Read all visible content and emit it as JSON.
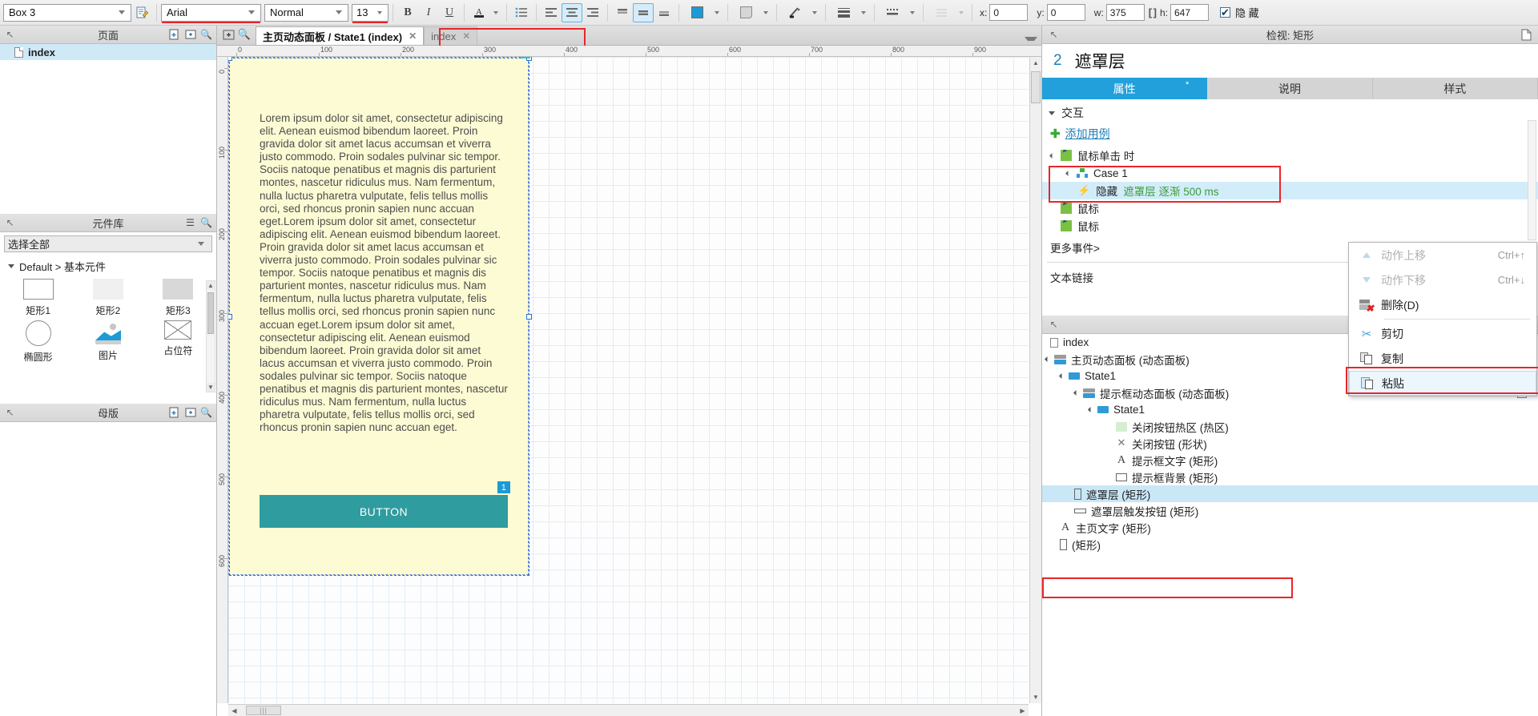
{
  "toolbar": {
    "widget_name": "Box 3",
    "font_family": "Arial",
    "font_style": "Normal",
    "font_size": "13",
    "bold": "B",
    "italic": "I",
    "underline": "U",
    "x_label": "x:",
    "x_value": "0",
    "y_label": "y:",
    "y_value": "0",
    "w_label": "w:",
    "w_value": "375",
    "h_label": "h:",
    "h_value": "647",
    "hide_label": "隐 藏",
    "hide_checked": true
  },
  "pages_panel": {
    "title": "页面",
    "items": [
      {
        "label": "index",
        "selected": true
      }
    ]
  },
  "library_panel": {
    "title": "元件库",
    "select_value": "选择全部",
    "group_label": "Default > 基本元件",
    "widgets": [
      {
        "label": "矩形1",
        "shape": "rect-outline"
      },
      {
        "label": "矩形2",
        "shape": "rect-light"
      },
      {
        "label": "矩形3",
        "shape": "rect-grey"
      },
      {
        "label": "椭圆形",
        "shape": "ellipse"
      },
      {
        "label": "图片",
        "shape": "image"
      },
      {
        "label": "占位符",
        "shape": "placeholder"
      }
    ]
  },
  "masters_panel": {
    "title": "母版"
  },
  "canvas": {
    "tabs": [
      {
        "label": "主页动态面板 / State1 (index)",
        "active": true,
        "highlighted": true
      },
      {
        "label": "index",
        "active": false,
        "highlighted": false
      }
    ],
    "ruler_top": [
      "0",
      "100",
      "200",
      "300",
      "400",
      "500",
      "600",
      "700",
      "800",
      "900"
    ],
    "ruler_left": [
      "0",
      "100",
      "200",
      "300",
      "400",
      "500",
      "600"
    ],
    "page_text": "Lorem ipsum dolor sit amet, consectetur adipiscing elit. Aenean euismod bibendum laoreet. Proin gravida dolor sit amet lacus accumsan et viverra justo commodo. Proin sodales pulvinar sic tempor. Sociis natoque penatibus et magnis dis parturient montes, nascetur ridiculus mus. Nam fermentum, nulla luctus pharetra vulputate, felis tellus mollis orci, sed rhoncus pronin sapien nunc accuan eget.Lorem ipsum dolor sit amet, consectetur adipiscing elit. Aenean euismod bibendum laoreet. Proin gravida dolor sit amet lacus accumsan et viverra justo commodo. Proin sodales pulvinar sic tempor. Sociis natoque penatibus et magnis dis parturient montes, nascetur ridiculus mus. Nam fermentum, nulla luctus pharetra vulputate, felis tellus mollis orci, sed rhoncus pronin sapien nunc accuan eget.Lorem ipsum dolor sit amet, consectetur adipiscing elit. Aenean euismod bibendum laoreet. Proin gravida dolor sit amet lacus accumsan et viverra justo commodo. Proin sodales pulvinar sic tempor. Sociis natoque penatibus et magnis dis parturient montes, nascetur ridiculus mus. Nam fermentum, nulla luctus pharetra vulputate, felis tellus mollis orci, sed rhoncus pronin sapien nunc accuan eget.",
    "button_label": "BUTTON",
    "button_badge": "1",
    "page_width": "375",
    "page_height": "647",
    "page_bg": "#fdfbd4",
    "button_color": "#2f9ca0"
  },
  "inspector": {
    "head_title": "检视: 矩形",
    "object_number": "2",
    "object_name": "遮罩层",
    "tabs": [
      {
        "label": "属性",
        "active": true,
        "marker": "*"
      },
      {
        "label": "说明",
        "active": false
      },
      {
        "label": "样式",
        "active": false
      }
    ],
    "section_label": "交互",
    "add_case_label": "添加用例",
    "event_label": "鼠标单击 时",
    "case_label": "Case 1",
    "action_prefix": "隐藏",
    "action_target": "遮罩层 逐渐 500 ms",
    "event_2": "鼠标",
    "event_3": "鼠标",
    "more_events": "更多事件>",
    "text_section": "文本链接"
  },
  "context_menu": {
    "items": [
      {
        "label": "动作上移",
        "shortcut": "Ctrl+↑",
        "icon": "arrow-up-icon",
        "disabled": true,
        "highlighted": false
      },
      {
        "label": "动作下移",
        "shortcut": "Ctrl+↓",
        "icon": "arrow-down-icon",
        "disabled": true,
        "highlighted": false
      },
      {
        "label": "删除(D)",
        "shortcut": "",
        "icon": "delete-icon",
        "disabled": false,
        "highlighted": false
      },
      {
        "label": "剪切",
        "shortcut": "",
        "icon": "cut-icon",
        "disabled": false,
        "highlighted": false,
        "sep_before": true
      },
      {
        "label": "复制",
        "shortcut": "",
        "icon": "copy-icon",
        "disabled": false,
        "highlighted": false
      },
      {
        "label": "粘贴",
        "shortcut": "",
        "icon": "paste-icon",
        "disabled": false,
        "highlighted": true
      }
    ]
  },
  "widget_tree": {
    "rows": [
      {
        "label": "index",
        "indent": 0,
        "icon": "document-icon",
        "tri": false,
        "selected": false
      },
      {
        "label": "主页动态面板 (动态面板)",
        "indent": 0,
        "icon": "dynamic-panel-icon",
        "tri": true,
        "selected": false
      },
      {
        "label": "State1",
        "indent": 1,
        "icon": "state-icon",
        "tri": true,
        "selected": false
      },
      {
        "label": "提示框动态面板 (动态面板)",
        "indent": 2,
        "icon": "dynamic-panel-icon",
        "tri": true,
        "selected": false,
        "eye": true
      },
      {
        "label": "State1",
        "indent": 3,
        "icon": "state-icon",
        "tri": true,
        "selected": false
      },
      {
        "label": "关闭按钮热区 (热区)",
        "indent": 4,
        "icon": "hotspot-icon",
        "tri": false,
        "selected": false
      },
      {
        "label": "关闭按钮 (形状)",
        "indent": 4,
        "icon": "close-shape-icon",
        "tri": false,
        "selected": false
      },
      {
        "label": "提示框文字 (矩形)",
        "indent": 4,
        "icon": "text-icon",
        "tri": false,
        "selected": false
      },
      {
        "label": "提示框背景 (矩形)",
        "indent": 4,
        "icon": "rect-icon",
        "tri": false,
        "selected": false
      },
      {
        "label": "遮罩层 (矩形)",
        "indent": 2,
        "icon": "vrect-icon",
        "tri": false,
        "selected": true
      },
      {
        "label": "遮罩层触发按钮 (矩形)",
        "indent": 2,
        "icon": "hline-icon",
        "tri": false,
        "selected": false
      },
      {
        "label": "主页文字 (矩形)",
        "indent": 1,
        "icon": "text-icon",
        "tri": false,
        "selected": false
      },
      {
        "label": "(矩形)",
        "indent": 1,
        "icon": "vrect-icon",
        "tri": false,
        "selected": false
      }
    ]
  }
}
